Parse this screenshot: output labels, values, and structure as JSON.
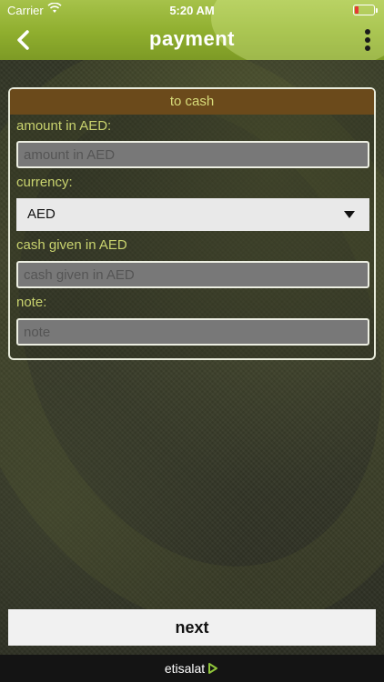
{
  "status_bar": {
    "carrier": "Carrier",
    "time": "5:20 AM",
    "battery_color": "#e53935"
  },
  "header": {
    "title": "payment",
    "back_icon": "chevron-left-icon",
    "menu_icon": "more-vertical-icon",
    "colors": {
      "bar": "#8fae2e"
    }
  },
  "form": {
    "section_title": "to cash",
    "amount": {
      "label": "amount in AED:",
      "placeholder": "amount in AED",
      "value": ""
    },
    "currency": {
      "label": "currency:",
      "selected": "AED"
    },
    "cash_given": {
      "label": "cash given in AED",
      "placeholder": "cash given in AED",
      "value": ""
    },
    "note": {
      "label": "note:",
      "placeholder": "note",
      "value": ""
    },
    "colors": {
      "header_bg": "#6b4a1b",
      "label": "#c9d36e"
    }
  },
  "actions": {
    "next_label": "next"
  },
  "footer": {
    "brand": "etisalat"
  }
}
